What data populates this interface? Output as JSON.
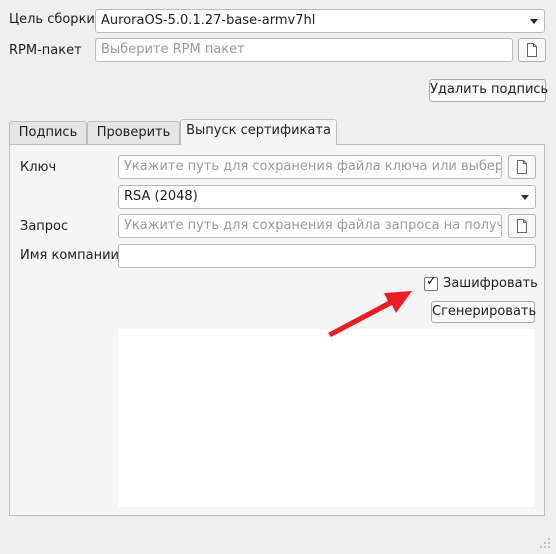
{
  "build_target": {
    "label": "Цель сборки",
    "value": "AuroraOS-5.0.1.27-base-armv7hl"
  },
  "rpm_package": {
    "label": "RPM-пакет",
    "placeholder": "Выберите RPM пакет"
  },
  "remove_signature_button": "Удалить подпись",
  "tabs": [
    {
      "label": "Подпись",
      "active": false
    },
    {
      "label": "Проверить",
      "active": false
    },
    {
      "label": "Выпуск сертификата",
      "active": true
    }
  ],
  "certificate": {
    "key": {
      "label": "Ключ",
      "placeholder": "Укажите путь для сохранения файла ключа или выберит..."
    },
    "algorithm": {
      "value": "RSA (2048)"
    },
    "request": {
      "label": "Запрос",
      "placeholder": "Укажите путь для сохранения файла запроса на получен..."
    },
    "company": {
      "label": "Имя компании",
      "value": ""
    },
    "encrypt": {
      "label": "Зашифровать",
      "checked": true
    },
    "generate_button": "Сгенерировать"
  },
  "annotation": {
    "color": "#ee1c24"
  }
}
